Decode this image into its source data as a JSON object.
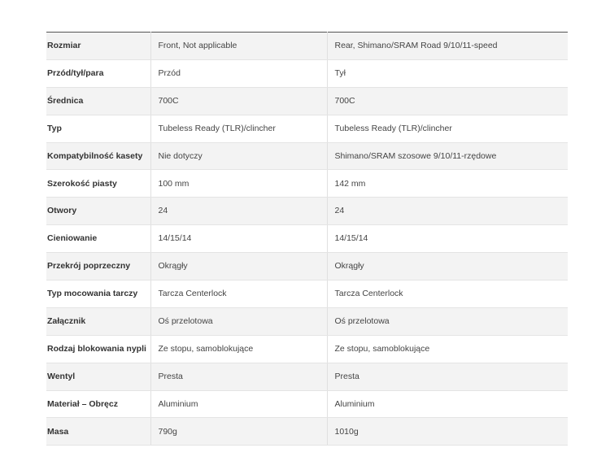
{
  "spec_table": {
    "rows": [
      {
        "label": "Rozmiar",
        "front": "Front, Not applicable",
        "rear": "Rear, Shimano/SRAM Road 9/10/11-speed"
      },
      {
        "label": "Przód/tył/para",
        "front": "Przód",
        "rear": "Tył"
      },
      {
        "label": "Średnica",
        "front": "700C",
        "rear": "700C"
      },
      {
        "label": "Typ",
        "front": "Tubeless Ready (TLR)/clincher",
        "rear": "Tubeless Ready (TLR)/clincher"
      },
      {
        "label": "Kompatybilność kasety",
        "front": "Nie dotyczy",
        "rear": "Shimano/SRAM szosowe 9/10/11-rzędowe"
      },
      {
        "label": "Szerokość piasty",
        "front": "100 mm",
        "rear": "142 mm"
      },
      {
        "label": "Otwory",
        "front": "24",
        "rear": "24"
      },
      {
        "label": "Cieniowanie",
        "front": "14/15/14",
        "rear": "14/15/14"
      },
      {
        "label": "Przekrój poprzeczny",
        "front": "Okrągły",
        "rear": "Okrągły"
      },
      {
        "label": "Typ mocowania tarczy",
        "front": "Tarcza Centerlock",
        "rear": "Tarcza Centerlock"
      },
      {
        "label": "Załącznik",
        "front": "Oś przelotowa",
        "rear": "Oś przelotowa"
      },
      {
        "label": "Rodzaj blokowania nypli",
        "front": "Ze stopu, samoblokujące",
        "rear": "Ze stopu, samoblokujące"
      },
      {
        "label": "Wentyl",
        "front": "Presta",
        "rear": "Presta"
      },
      {
        "label": "Materiał – Obręcz",
        "front": "Aluminium",
        "rear": "Aluminium"
      },
      {
        "label": "Masa",
        "front": "790g",
        "rear": "1010g"
      }
    ]
  }
}
